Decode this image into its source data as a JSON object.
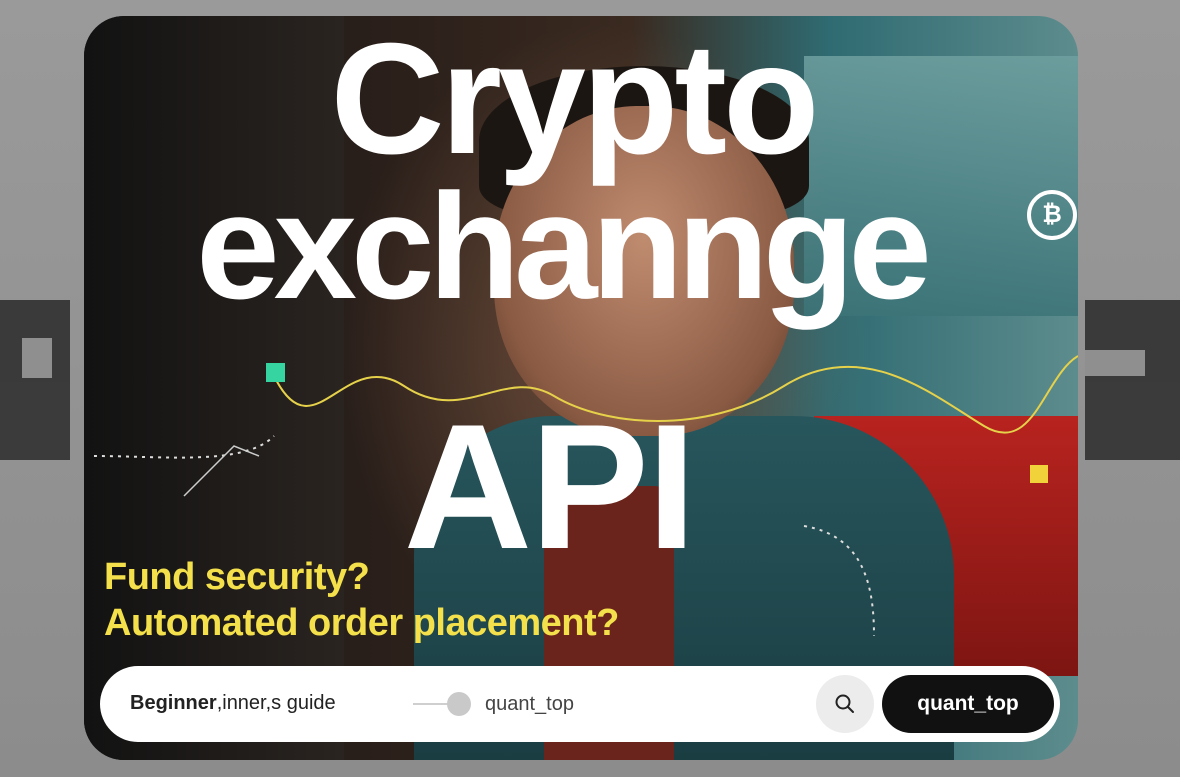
{
  "headline": {
    "line1": "Crypto",
    "line2": "exchannge",
    "line3": "API",
    "badge_symbol": "₿"
  },
  "questions": {
    "q1": "Fund security?",
    "q2": "Automated order placement?"
  },
  "bottom_bar": {
    "guide_bold": "Beginner",
    "guide_rest": ",inner,s guide",
    "slider_label": "quant_top",
    "search_icon": "search-icon",
    "cta_label": "quant_top"
  },
  "colors": {
    "title": "#ffffff",
    "question_text": "#f4e04a",
    "accent_green": "#35d4a0",
    "accent_yellow": "#f2d23a",
    "cta_bg": "#111111"
  }
}
